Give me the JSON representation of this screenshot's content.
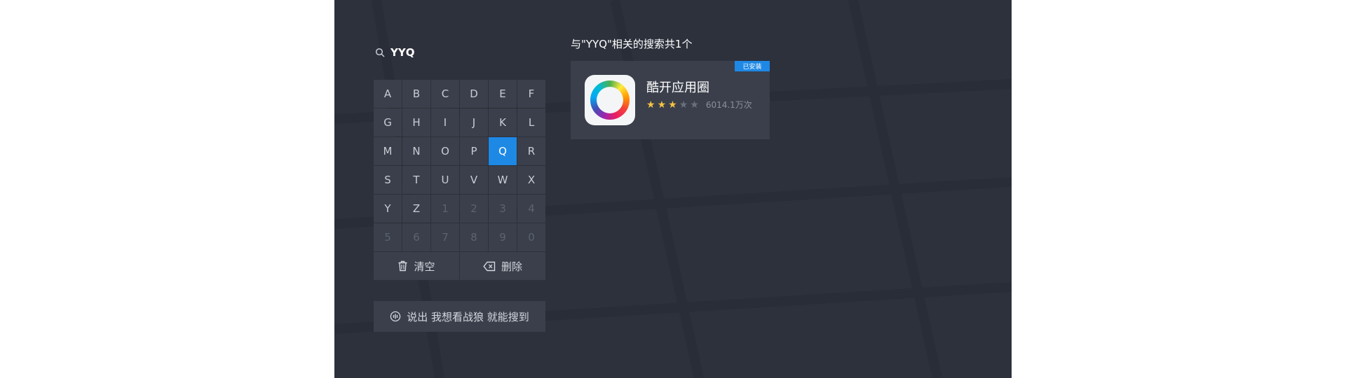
{
  "search": {
    "query": "YYQ",
    "icon": "search-icon"
  },
  "keyboard": {
    "keys": [
      "A",
      "B",
      "C",
      "D",
      "E",
      "F",
      "G",
      "H",
      "I",
      "J",
      "K",
      "L",
      "M",
      "N",
      "O",
      "P",
      "Q",
      "R",
      "S",
      "T",
      "U",
      "V",
      "W",
      "X",
      "Y",
      "Z",
      "1",
      "2",
      "3",
      "4",
      "5",
      "6",
      "7",
      "8",
      "9",
      "0"
    ],
    "active_key": "Q",
    "enabled_keys": "ABCDEFGHIJKLMNOPQRSTUVWXYZ"
  },
  "actions": {
    "clear_label": "清空",
    "delete_label": "删除"
  },
  "voice_hint": {
    "label": "说出 我想看战狼 就能搜到"
  },
  "results": {
    "summary": "与\"YYQ\"相关的搜索共1个",
    "items": [
      {
        "name": "酷开应用圈",
        "badge": "已安装",
        "rating": 3,
        "rating_max": 5,
        "downloads": "6014.1万次"
      }
    ]
  },
  "colors": {
    "background": "#2d313c",
    "key": "#3a3f4b",
    "accent": "#1e88e5",
    "star": "#f5c342"
  }
}
